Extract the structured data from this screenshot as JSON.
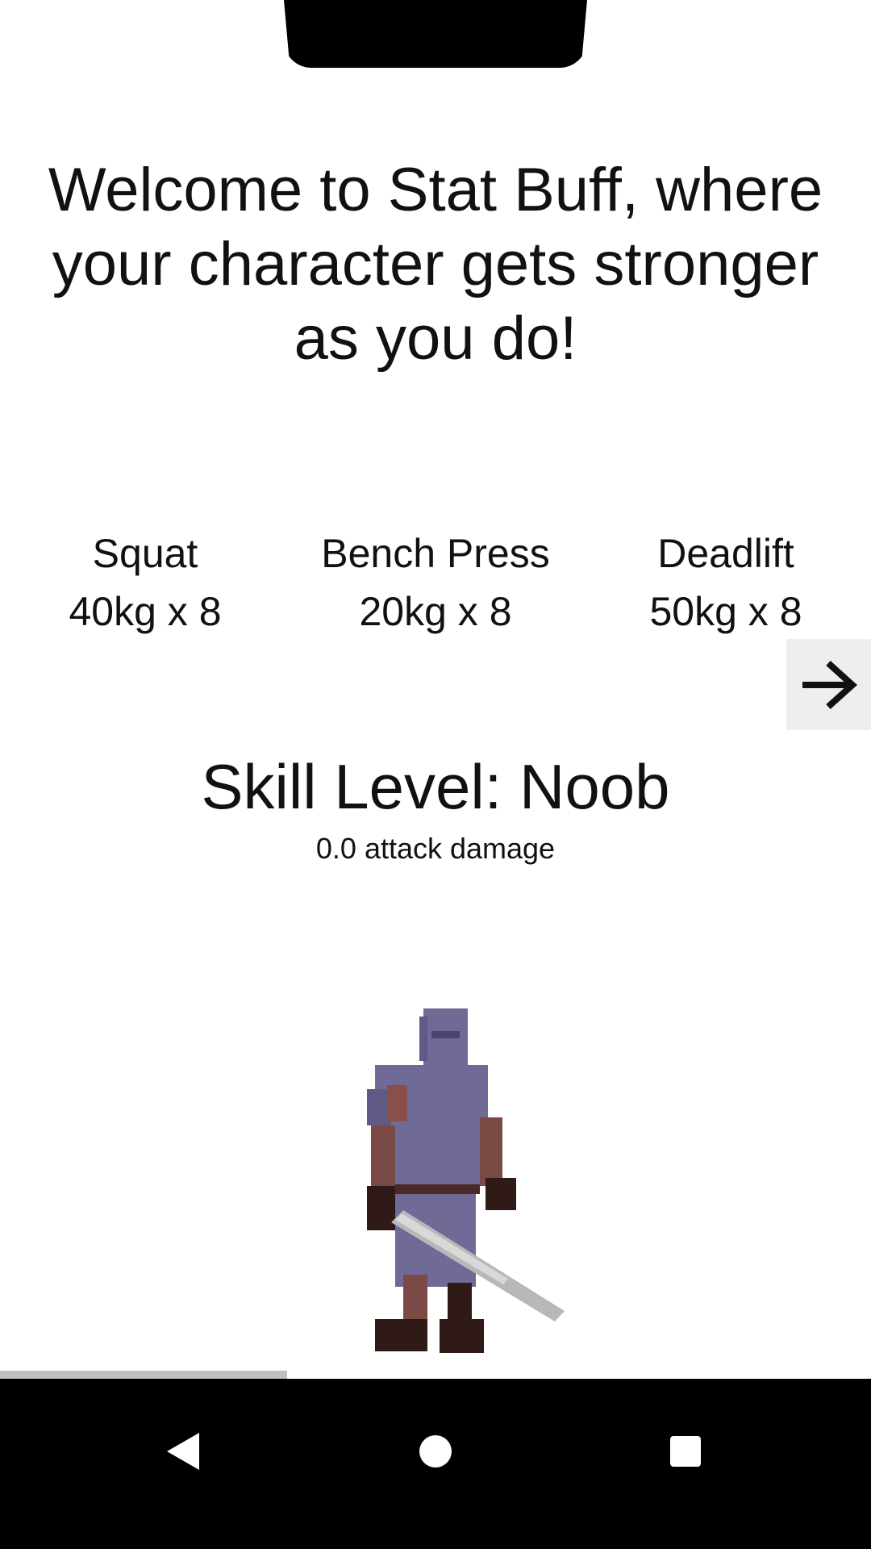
{
  "intro": {
    "welcome_text": "Welcome to Stat Buff, where your character gets stronger as you do!"
  },
  "exercises": [
    {
      "name": "Squat",
      "detail": "40kg x 8"
    },
    {
      "name": "Bench Press",
      "detail": "20kg x 8"
    },
    {
      "name": "Deadlift",
      "detail": "50kg x 8"
    }
  ],
  "next_button": {
    "icon": "arrow-right-icon"
  },
  "skill": {
    "level_text": "Skill Level: Noob",
    "attack_text": "0.0 attack damage"
  },
  "character": {
    "icon": "knight-sprite"
  },
  "progress": {
    "fraction": 0.33
  },
  "navigation": {
    "back_icon": "back-triangle-icon",
    "home_icon": "home-circle-icon",
    "recents_icon": "recents-square-icon"
  },
  "colors": {
    "background": "#ffffff",
    "text": "#111111",
    "next_button_bg": "#eeeeee",
    "progress_fill": "#c0c0c0",
    "navbar": "#000000",
    "armor": "#6f6b96",
    "skin": "#7a4a44"
  }
}
